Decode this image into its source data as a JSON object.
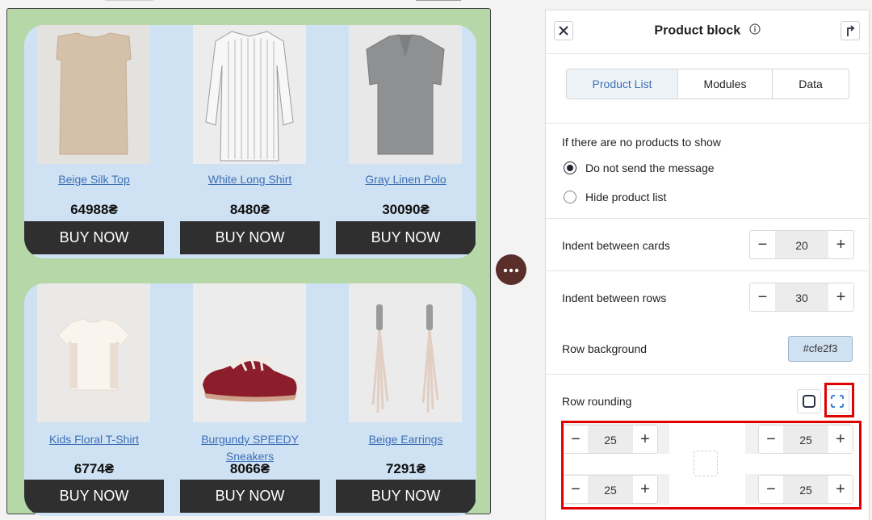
{
  "products": {
    "rows": [
      [
        {
          "name": "Beige Silk Top",
          "price": "64988₴",
          "buy": "BUY NOW"
        },
        {
          "name": "White Long Shirt",
          "price": "8480₴",
          "buy": "BUY NOW"
        },
        {
          "name": "Gray Linen Polo",
          "price": "30090₴",
          "buy": "BUY NOW"
        }
      ],
      [
        {
          "name": "Kids Floral T-Shirt",
          "price": "6774₴",
          "buy": "BUY NOW"
        },
        {
          "name": "Burgundy SPEEDY Sneakers",
          "price": "8066₴",
          "buy": "BUY NOW"
        },
        {
          "name": "Beige Earrings",
          "price": "7291₴",
          "buy": "BUY NOW"
        }
      ]
    ]
  },
  "panel": {
    "title": "Product block",
    "tabs": [
      "Product List",
      "Modules",
      "Data"
    ],
    "active_tab": "Product List",
    "no_products_label": "If there are no products to show",
    "options": [
      "Do not send the message",
      "Hide product list"
    ],
    "selected_option": "Do not send the message",
    "indent_cards_label": "Indent between cards",
    "indent_cards_value": "20",
    "indent_rows_label": "Indent between rows",
    "indent_rows_value": "30",
    "row_background_label": "Row background",
    "row_background_value": "#cfe2f3",
    "row_rounding_label": "Row rounding",
    "corners": {
      "top_left": "25",
      "top_right": "25",
      "bottom_left": "25",
      "bottom_right": "25"
    }
  },
  "colors": {
    "block_bg": "#b6d7a8",
    "row_bg": "#cfe2f3",
    "buy_bg": "#2f2f2f",
    "link": "#3d6fb6",
    "highlight": "#e00000",
    "more_button": "#5a2e2a"
  },
  "icons": {
    "close": "close-icon",
    "info": "info-icon",
    "collapse": "collapse-arrow-icon",
    "more": "more-dots-icon",
    "uniform": "uniform-corners-icon",
    "individual": "individual-corners-icon"
  }
}
